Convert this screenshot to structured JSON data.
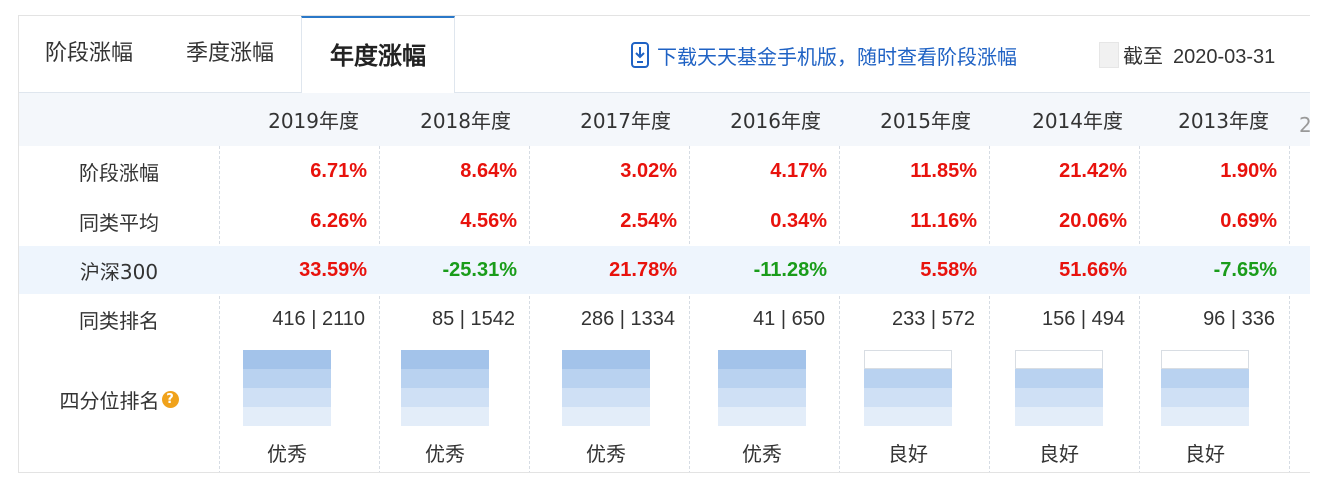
{
  "tabs": [
    {
      "label": "阶段涨幅",
      "active": false
    },
    {
      "label": "季度涨幅",
      "active": false
    },
    {
      "label": "年度涨幅",
      "active": true
    }
  ],
  "download_text": "下载天天基金手机版，随时查看阶段涨幅",
  "asof": {
    "label": "截至",
    "date": "2020-03-31"
  },
  "columns": [
    "2019年度",
    "2018年度",
    "2017年度",
    "2016年度",
    "2015年度",
    "2014年度",
    "2013年度"
  ],
  "rows": {
    "stage_return": {
      "label": "阶段涨幅",
      "values": [
        "6.71%",
        "8.64%",
        "3.02%",
        "4.17%",
        "11.85%",
        "21.42%",
        "1.90%"
      ]
    },
    "category_avg": {
      "label": "同类平均",
      "values": [
        "6.26%",
        "4.56%",
        "2.54%",
        "0.34%",
        "11.16%",
        "20.06%",
        "0.69%"
      ]
    },
    "hs300": {
      "label": "沪深300",
      "values": [
        "33.59%",
        "-25.31%",
        "21.78%",
        "-11.28%",
        "5.58%",
        "51.66%",
        "-7.65%"
      ]
    },
    "category_rank": {
      "label": "同类排名",
      "values": [
        "416 | 2110",
        "85 | 1542",
        "286 | 1334",
        "41 | 650",
        "233 | 572",
        "156 | 494",
        "96 | 336"
      ]
    },
    "quartile": {
      "label": "四分位排名",
      "levels": [
        4,
        4,
        4,
        4,
        3,
        3,
        3
      ],
      "ratings": [
        "优秀",
        "优秀",
        "优秀",
        "优秀",
        "良好",
        "良好",
        "良好"
      ]
    }
  },
  "colors": {
    "up": "#e8120c",
    "down": "#1a9c1a",
    "accent": "#2a78c8",
    "link": "#1f62c4",
    "quartile_fills": [
      "#e3edf9",
      "#cfe0f5",
      "#b9d2f0",
      "#a3c3ea"
    ]
  },
  "icons": {
    "download": "phone-download-icon",
    "help": "help-circle-icon"
  }
}
